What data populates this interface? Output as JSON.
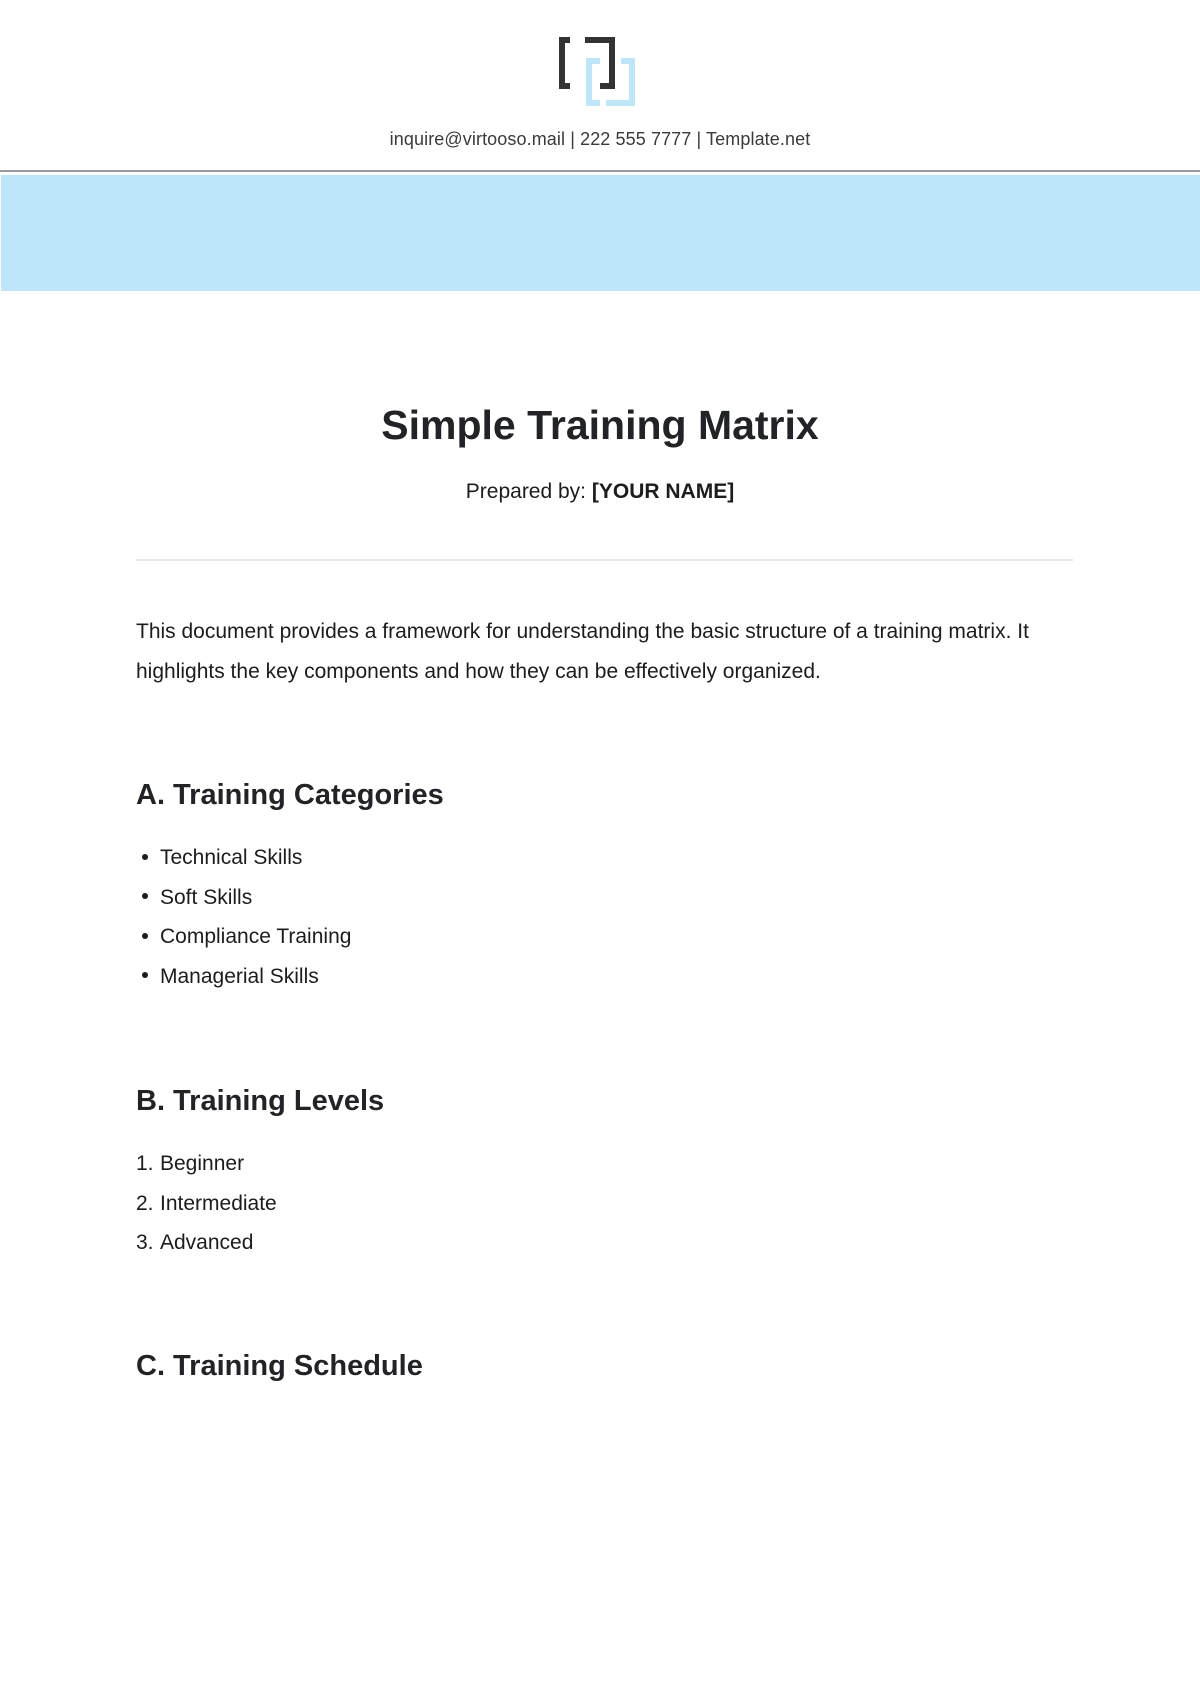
{
  "header": {
    "logo_icon": "bracket-logo-icon",
    "contact_line": "inquire@virtooso.mail | 222 555 7777 | Template.net",
    "colors": {
      "logo_dark": "#333333",
      "logo_light": "#bde6fb",
      "banner": "#bde6fb"
    }
  },
  "document": {
    "title": "Simple Training Matrix",
    "prepared_label": "Prepared by:",
    "prepared_name": "[YOUR NAME]",
    "intro": "This document provides a framework for understanding the basic structure of a training matrix. It highlights the key components and how they can be effectively organized."
  },
  "sections": [
    {
      "heading": "A. Training Categories",
      "list_type": "bullet",
      "items": [
        "Technical Skills",
        "Soft Skills",
        "Compliance Training",
        "Managerial Skills"
      ]
    },
    {
      "heading": "B. Training Levels",
      "list_type": "numbered",
      "items": [
        "Beginner",
        "Intermediate",
        "Advanced"
      ],
      "markers": [
        "1.",
        "2.",
        "3."
      ]
    },
    {
      "heading": "C. Training Schedule"
    }
  ]
}
